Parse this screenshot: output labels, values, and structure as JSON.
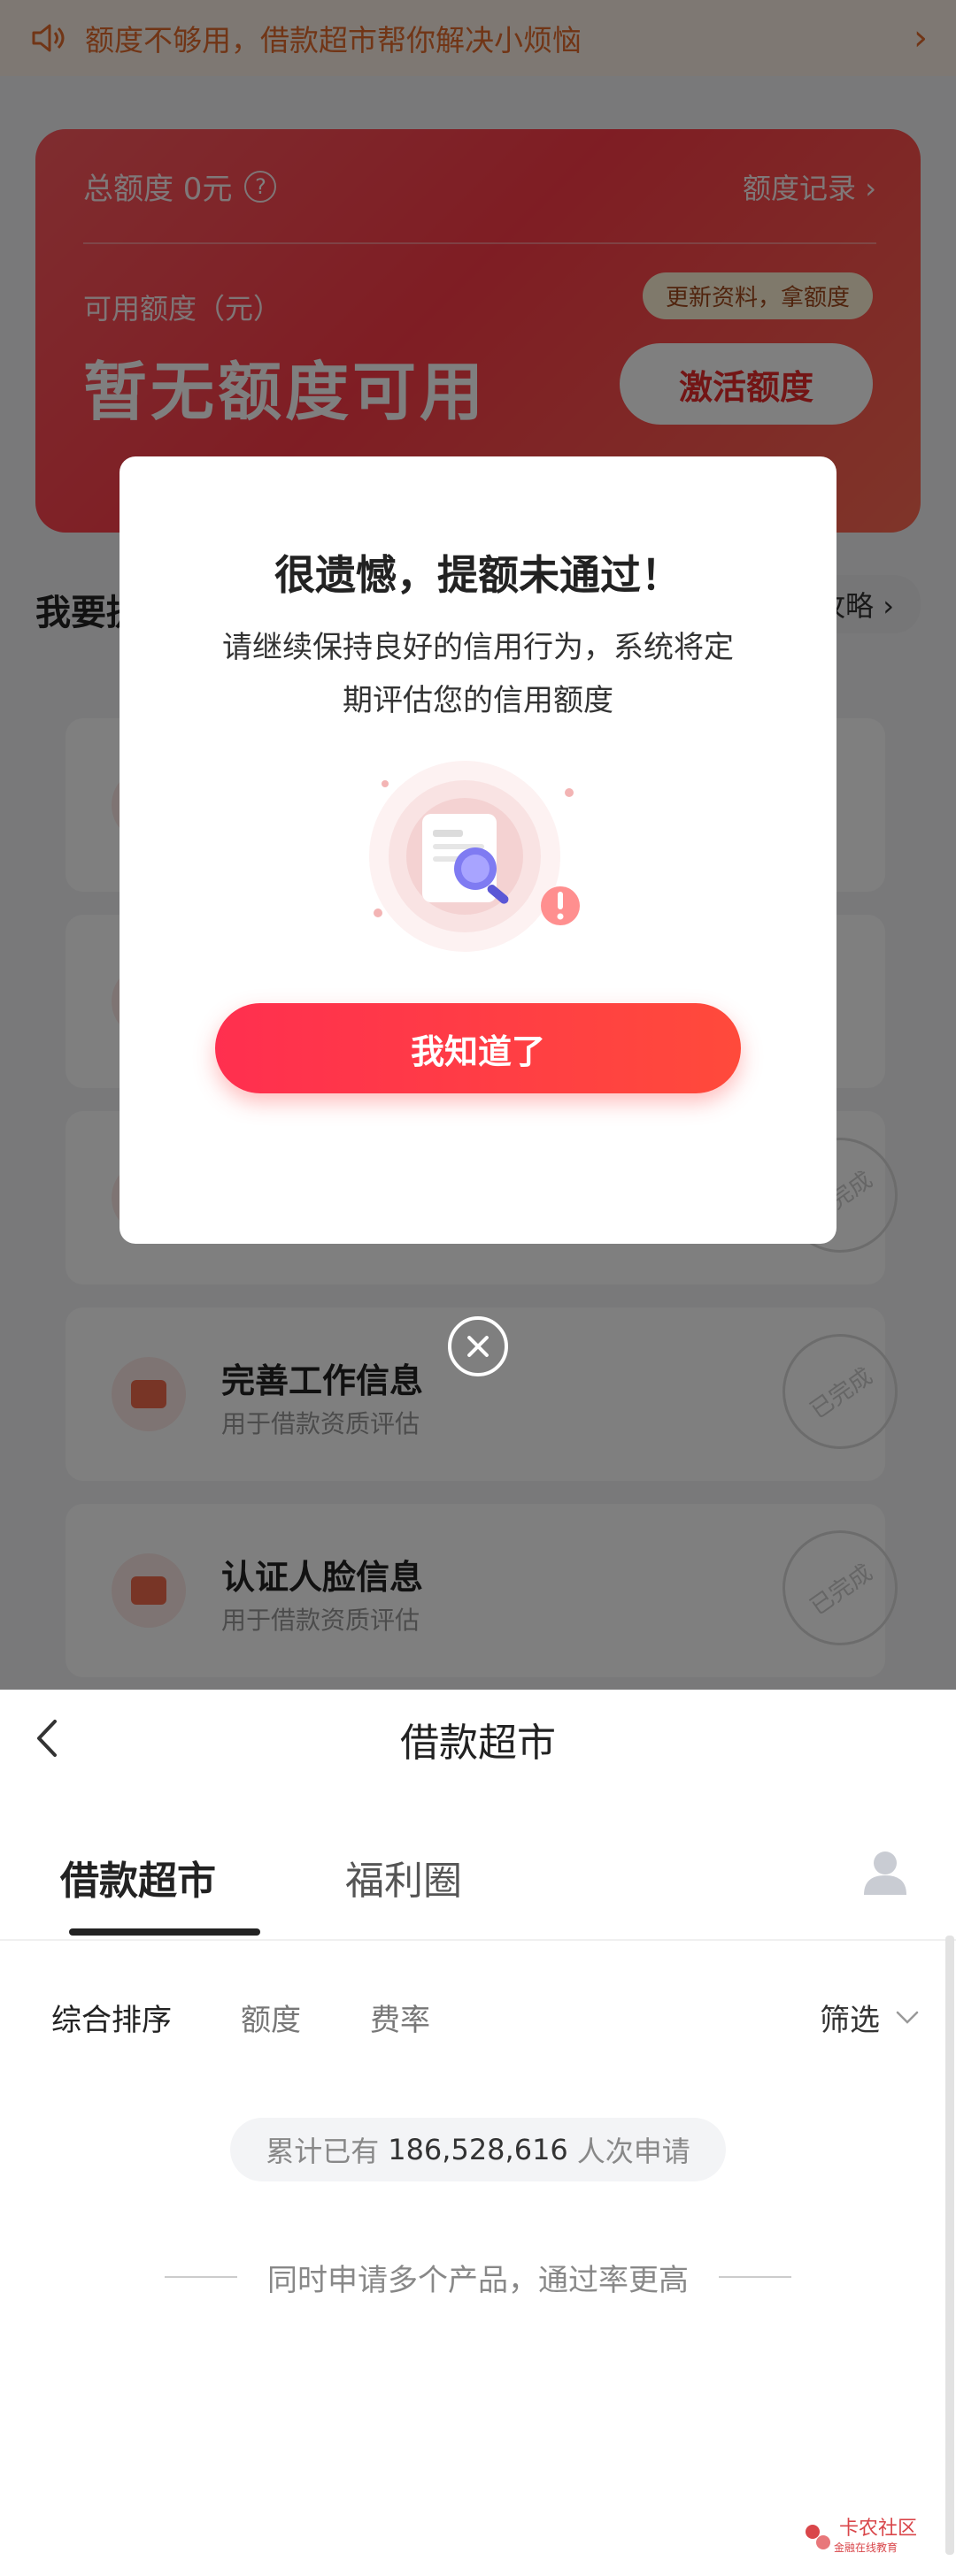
{
  "top": {
    "notice": "额度不够用，借款超市帮你解决小烦恼",
    "credit": {
      "total_label": "总额度 0元",
      "record_link": "额度记录 ›",
      "available_label": "可用额度（元）",
      "no_credit": "暂无额度可用",
      "tag": "更新资料，拿额度",
      "activate_button": "激活额度"
    },
    "section_title": "我要提额",
    "strategy": "提额攻略 ›",
    "tasks": [
      {
        "title": "",
        "subtitle": "",
        "status": ""
      },
      {
        "title": "",
        "subtitle": "",
        "status": ""
      },
      {
        "title": "",
        "subtitle": "",
        "status": "已完成"
      },
      {
        "title": "完善工作信息",
        "subtitle": "用于借款资质评估",
        "status": "已完成"
      },
      {
        "title": "认证人脸信息",
        "subtitle": "用于借款资质评估",
        "status": "已完成"
      }
    ]
  },
  "modal": {
    "title": "很遗憾，提额未通过！",
    "description": "请继续保持良好的信用行为，系统将定期评估您的信用额度",
    "button": "我知道了"
  },
  "market": {
    "nav_title": "借款超市",
    "tabs": [
      {
        "label": "借款超市",
        "active": true
      },
      {
        "label": "福利圈",
        "active": false
      }
    ],
    "filters": [
      "综合排序",
      "额度",
      "费率"
    ],
    "filter_right": "筛选",
    "stats_prefix": "累计已有",
    "stats_number": "186,528,616",
    "stats_suffix": "人次申请",
    "tip": "同时申请多个产品，通过率更高"
  },
  "watermark": {
    "text": "卡农社区",
    "sub": "金融在线教育"
  },
  "colors": {
    "accent": "#ff3b48",
    "notice": "#e26b2d"
  },
  "icons": {
    "speaker": "speaker-icon",
    "close": "close-icon",
    "back": "back-arrow-icon",
    "user": "user-icon",
    "help": "question-icon"
  }
}
